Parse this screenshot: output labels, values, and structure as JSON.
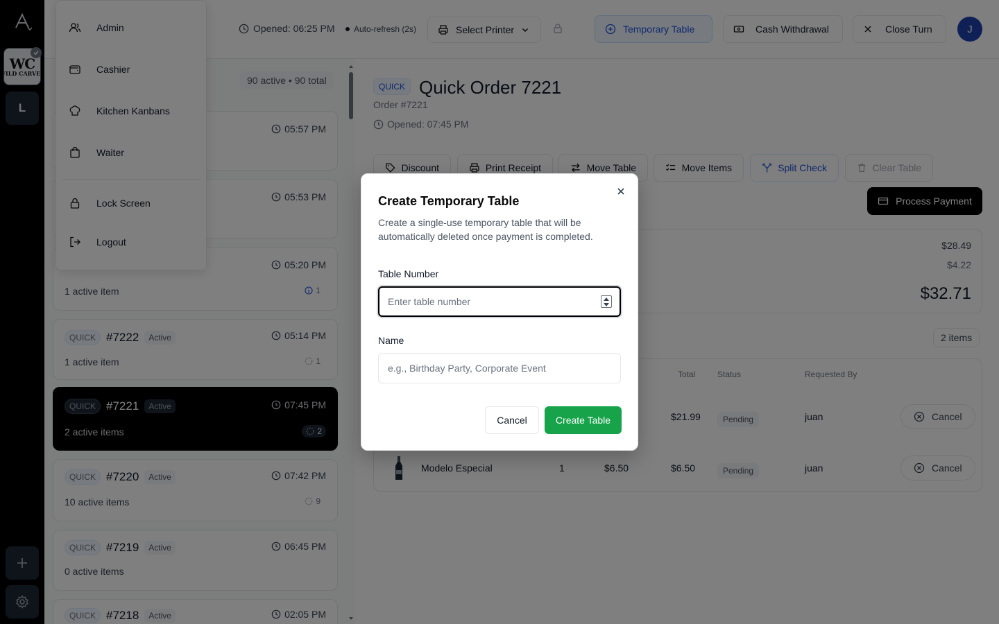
{
  "store": {
    "logo_big": "WC",
    "logo_small": "WILD CARVER",
    "location_initial": "L"
  },
  "header": {
    "opened": "Opened: 06:25 PM",
    "auto_refresh": "Auto-refresh (2s)",
    "select_printer": "Select Printer",
    "temporary_table": "Temporary Table",
    "cash_withdrawal": "Cash Withdrawal",
    "close_turn": "Close Turn",
    "user_initial": "J"
  },
  "user_menu": {
    "items": [
      "Admin",
      "Cashier",
      "Kitchen Kanbans",
      "Waiter"
    ],
    "lock": "Lock Screen",
    "logout": "Logout"
  },
  "order_list": {
    "summary": "90 active • 90 total",
    "hidden_times": [
      "05:57 PM",
      "05:53 PM"
    ],
    "orders": [
      {
        "tag": "",
        "number": "",
        "status": "",
        "time": "05:20 PM",
        "items": "1 active item",
        "count": "1"
      },
      {
        "tag": "QUICK",
        "number": "#7222",
        "status": "Active",
        "time": "05:14 PM",
        "items": "1 active item",
        "count": "1"
      },
      {
        "tag": "QUICK",
        "number": "#7221",
        "status": "Active",
        "time": "07:45 PM",
        "items": "2 active items",
        "count": "2"
      },
      {
        "tag": "QUICK",
        "number": "#7220",
        "status": "Active",
        "time": "07:42 PM",
        "items": "10 active items",
        "count": "9"
      },
      {
        "tag": "QUICK",
        "number": "#7219",
        "status": "Active",
        "time": "06:45 PM",
        "items": "0 active items",
        "count": ""
      },
      {
        "tag": "QUICK",
        "number": "#7218",
        "status": "Active",
        "time": "02:05 PM",
        "items": "",
        "count": ""
      }
    ]
  },
  "detail": {
    "tag": "QUICK",
    "title": "Quick Order 7221",
    "order_no": "Order #7221",
    "opened": "Opened: 07:45 PM",
    "actions": [
      "Discount",
      "Print Receipt",
      "Move Table",
      "Move Items",
      "Split Check",
      "Clear Table"
    ],
    "process_payment": "Process Payment",
    "subtotal": "$28.49",
    "tax": "$4.22",
    "total": "$32.71",
    "items_badge": "2 items",
    "columns": [
      "Total",
      "Status",
      "Requested By"
    ],
    "rows": [
      {
        "name": "",
        "qty": "",
        "price": "",
        "total": "$21.99",
        "status": "Pending",
        "by": "juan",
        "action": "Cancel"
      },
      {
        "name": "Modelo Especial",
        "qty": "1",
        "price": "$6.50",
        "total": "$6.50",
        "status": "Pending",
        "by": "juan",
        "action": "Cancel"
      }
    ]
  },
  "modal": {
    "title": "Create Temporary Table",
    "description": "Create a single-use temporary table that will be automatically deleted once payment is completed.",
    "table_label": "Table Number",
    "table_placeholder": "Enter table number",
    "table_value": "",
    "name_label": "Name",
    "name_placeholder": "e.g., Birthday Party, Corporate Event",
    "name_value": "",
    "cancel": "Cancel",
    "create": "Create Table"
  },
  "colors": {
    "accent_green": "#16a34a",
    "accent_blue": "#1d4ed8",
    "overlay": "rgba(0,0,0,0.5)",
    "selected_card": "#000000"
  }
}
